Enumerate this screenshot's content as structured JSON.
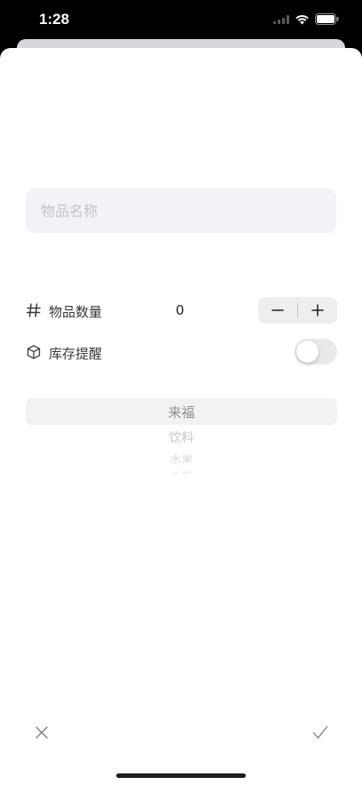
{
  "status_bar": {
    "time": "1:28"
  },
  "form": {
    "name_placeholder": "物品名称",
    "name_value": "",
    "quantity": {
      "label": "物品数量",
      "value": "0",
      "icon": "hash-icon",
      "decrement_icon": "minus-icon",
      "increment_icon": "plus-icon"
    },
    "stock_reminder": {
      "label": "库存提醒",
      "icon": "cube-icon",
      "enabled": false
    }
  },
  "category_picker": {
    "selected": "来福",
    "items": [
      "来福",
      "饮料",
      "水果",
      "主食"
    ]
  },
  "bottom_bar": {
    "cancel_icon": "close-icon",
    "confirm_icon": "checkmark-icon"
  },
  "colors": {
    "accent_grey": "#8e8e93",
    "field_bg": "#f2f2f7",
    "toggle_off": "#e9e9eb"
  }
}
